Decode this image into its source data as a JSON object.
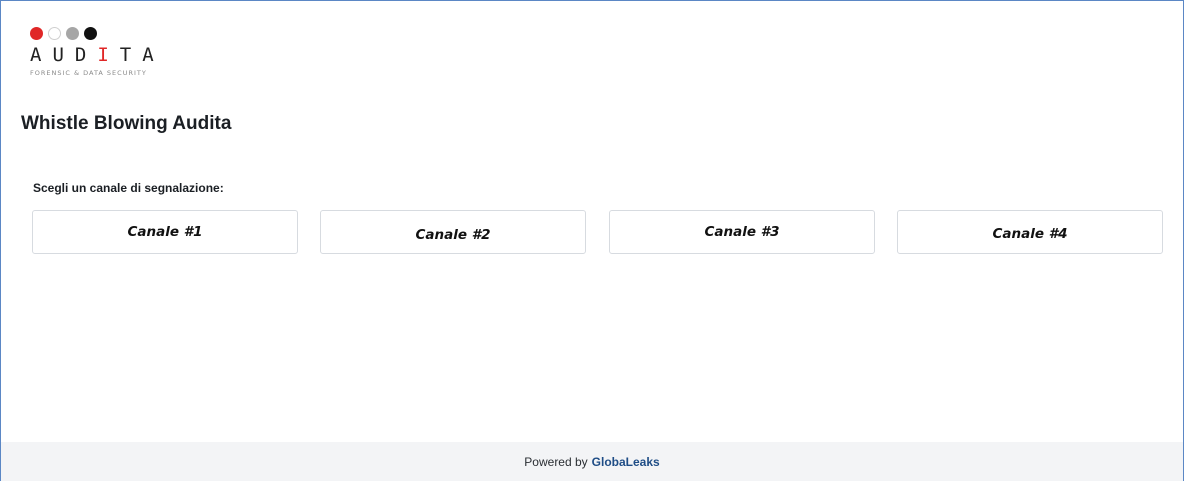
{
  "logo": {
    "dots": [
      "#e02727",
      "#ffffff",
      "#a6a6a6",
      "#111111"
    ],
    "brand_plain_1": "AUD",
    "brand_red": "I",
    "brand_plain_2": "TA",
    "tagline": "FORENSIC & DATA SECURITY"
  },
  "page": {
    "title": "Whistle Blowing Audita",
    "prompt": "Scegli un canale di segnalazione:"
  },
  "channels": [
    {
      "label": "Canale #1"
    },
    {
      "label": "Canale #2"
    },
    {
      "label": "Canale #3"
    },
    {
      "label": "Canale #4"
    }
  ],
  "footer": {
    "powered_by": "Powered by",
    "link": "GlobaLeaks"
  },
  "colors": {
    "accent_red": "#e02727",
    "link_blue": "#1f4d86",
    "footer_bg": "#f3f4f6"
  }
}
